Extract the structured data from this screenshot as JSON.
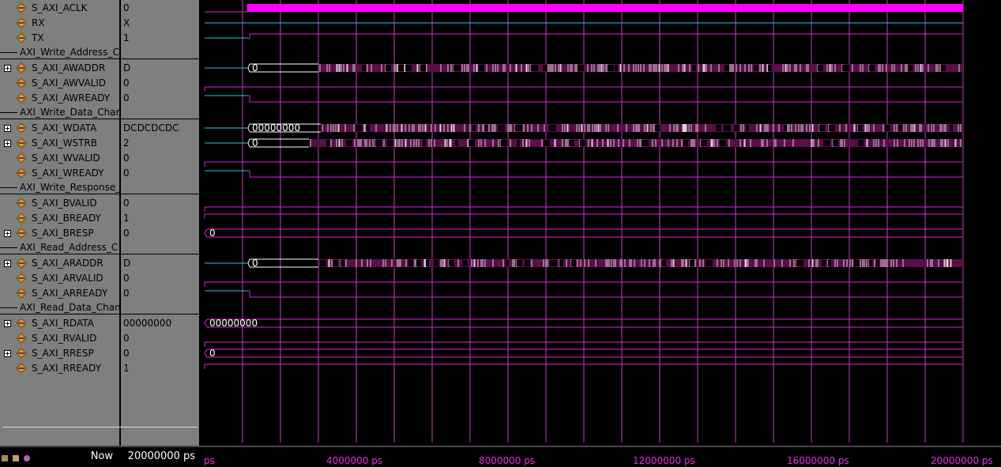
{
  "signals": [
    {
      "name": "S_AXI_ACLK",
      "value": "0",
      "expandable": false
    },
    {
      "name": "RX",
      "value": "X",
      "expandable": false
    },
    {
      "name": "TX",
      "value": "1",
      "expandable": false
    },
    {
      "group": "AXI_Write_Address_C"
    },
    {
      "name": "S_AXI_AWADDR",
      "value": "D",
      "expandable": true,
      "bus_init": "0"
    },
    {
      "name": "S_AXI_AWVALID",
      "value": "0",
      "expandable": false
    },
    {
      "name": "S_AXI_AWREADY",
      "value": "0",
      "expandable": false
    },
    {
      "group": "AXI_Write_Data_Char"
    },
    {
      "name": "S_AXI_WDATA",
      "value": "DCDCDCDC",
      "expandable": true,
      "bus_init": "00000000"
    },
    {
      "name": "S_AXI_WSTRB",
      "value": "2",
      "expandable": true,
      "bus_init": "0"
    },
    {
      "name": "S_AXI_WVALID",
      "value": "0",
      "expandable": false
    },
    {
      "name": "S_AXI_WREADY",
      "value": "0",
      "expandable": false
    },
    {
      "group": "AXI_Write_Response_"
    },
    {
      "name": "S_AXI_BVALID",
      "value": "0",
      "expandable": false
    },
    {
      "name": "S_AXI_BREADY",
      "value": "1",
      "expandable": false
    },
    {
      "name": "S_AXI_BRESP",
      "value": "0",
      "expandable": true,
      "bus_init": "0"
    },
    {
      "group": "AXI_Read_Address_C"
    },
    {
      "name": "S_AXI_ARADDR",
      "value": "D",
      "expandable": true,
      "bus_init": "0"
    },
    {
      "name": "S_AXI_ARVALID",
      "value": "0",
      "expandable": false
    },
    {
      "name": "S_AXI_ARREADY",
      "value": "0",
      "expandable": false
    },
    {
      "group": "AXI_Read_Data_Chan"
    },
    {
      "name": "S_AXI_RDATA",
      "value": "00000000",
      "expandable": true,
      "bus_init": "00000000"
    },
    {
      "name": "S_AXI_RVALID",
      "value": "0",
      "expandable": false
    },
    {
      "name": "S_AXI_RRESP",
      "value": "0",
      "expandable": true,
      "bus_init": "0"
    },
    {
      "name": "S_AXI_RREADY",
      "value": "1",
      "expandable": false
    }
  ],
  "footer": {
    "now_label": "Now",
    "now_value": "20000000 ps"
  },
  "axis": {
    "ticks": [
      "ps",
      "4000000 ps",
      "8000000 ps",
      "12000000 ps",
      "16000000 ps",
      "20000000 ps"
    ]
  },
  "colors": {
    "wave": "#e020e0",
    "cyan": "#22c8e0",
    "bus_fill": "#5a0e4a",
    "bus_text": "#ffffff",
    "grid": "#c040c0",
    "clock_fill": "#ff00ff"
  }
}
